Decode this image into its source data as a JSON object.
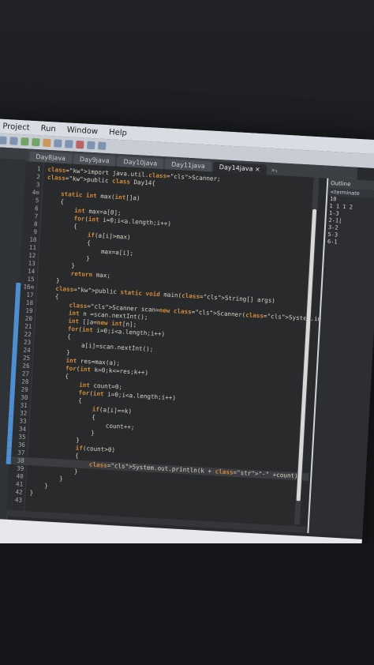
{
  "menu": [
    "Project",
    "Run",
    "Window",
    "Help"
  ],
  "tabs": [
    {
      "label": "Day8java",
      "active": false
    },
    {
      "label": "Day9java",
      "active": false
    },
    {
      "label": "Day10java",
      "active": false
    },
    {
      "label": "Day11java",
      "active": false
    },
    {
      "label": "Day14java ×",
      "active": true
    }
  ],
  "tab_more": "»₁",
  "right_panel": {
    "title": "Outline",
    "subtitle": "<terminate",
    "lines": [
      "10",
      "1 1 1 2",
      "1-3",
      "2-1|",
      "3-2",
      "5-3",
      "6-1"
    ]
  },
  "code_lines": [
    {
      "n": "1",
      "t": "import java.util.Scanner;"
    },
    {
      "n": "2",
      "t": "public class Day14{"
    },
    {
      "n": "3",
      "t": ""
    },
    {
      "n": "4⊖",
      "t": "    static int max(int[]a)"
    },
    {
      "n": "5",
      "t": "    {"
    },
    {
      "n": "6",
      "t": "        int max=a[0];"
    },
    {
      "n": "7",
      "t": "        for(int i=0;i<a.length;i++)"
    },
    {
      "n": "8",
      "t": "        {"
    },
    {
      "n": "9",
      "t": "            if(a[i]>max)"
    },
    {
      "n": "10",
      "t": "            {"
    },
    {
      "n": "11",
      "t": "                max=a[i];"
    },
    {
      "n": "12",
      "t": "            }"
    },
    {
      "n": "13",
      "t": "        }"
    },
    {
      "n": "14",
      "t": "        return max;"
    },
    {
      "n": "15",
      "t": "    }"
    },
    {
      "n": "16⊖",
      "t": "    public static void main(String[] args)"
    },
    {
      "n": "17",
      "t": "    {"
    },
    {
      "n": "18",
      "t": "        Scanner scan=new Scanner(System.in);"
    },
    {
      "n": "19",
      "t": "        int n =scan.nextInt();"
    },
    {
      "n": "20",
      "t": "        int []a=new int[n];"
    },
    {
      "n": "21",
      "t": "        for(int i=0;i<a.length;i++)"
    },
    {
      "n": "22",
      "t": "        {"
    },
    {
      "n": "23",
      "t": "            a[i]=scan.nextInt();"
    },
    {
      "n": "24",
      "t": "        }"
    },
    {
      "n": "25",
      "t": "        int res=max(a);"
    },
    {
      "n": "26",
      "t": "        for(int k=0;k<=res;k++)"
    },
    {
      "n": "27",
      "t": "        {"
    },
    {
      "n": "28",
      "t": "            int count=0;"
    },
    {
      "n": "29",
      "t": "            for(int i=0;i<a.length;i++)"
    },
    {
      "n": "30",
      "t": "            {"
    },
    {
      "n": "31",
      "t": "                if(a[i]==k)"
    },
    {
      "n": "32",
      "t": "                {"
    },
    {
      "n": "33",
      "t": "                    count++;"
    },
    {
      "n": "34",
      "t": "                }"
    },
    {
      "n": "35",
      "t": "            }"
    },
    {
      "n": "36",
      "t": "            if(count>0)"
    },
    {
      "n": "37",
      "t": "            {"
    },
    {
      "n": "38",
      "t": "                System.out.println(k + \"-\" +count);"
    },
    {
      "n": "39",
      "t": "            }"
    },
    {
      "n": "40",
      "t": "        }"
    },
    {
      "n": "41",
      "t": "    }"
    },
    {
      "n": "42",
      "t": "}"
    },
    {
      "n": "43",
      "t": ""
    }
  ],
  "highlighted_line": "38",
  "colors": {
    "keyword": "#d08a3a",
    "string": "#c8d37a",
    "class_ref": "#7da7d6",
    "text": "#d7d3c4"
  }
}
